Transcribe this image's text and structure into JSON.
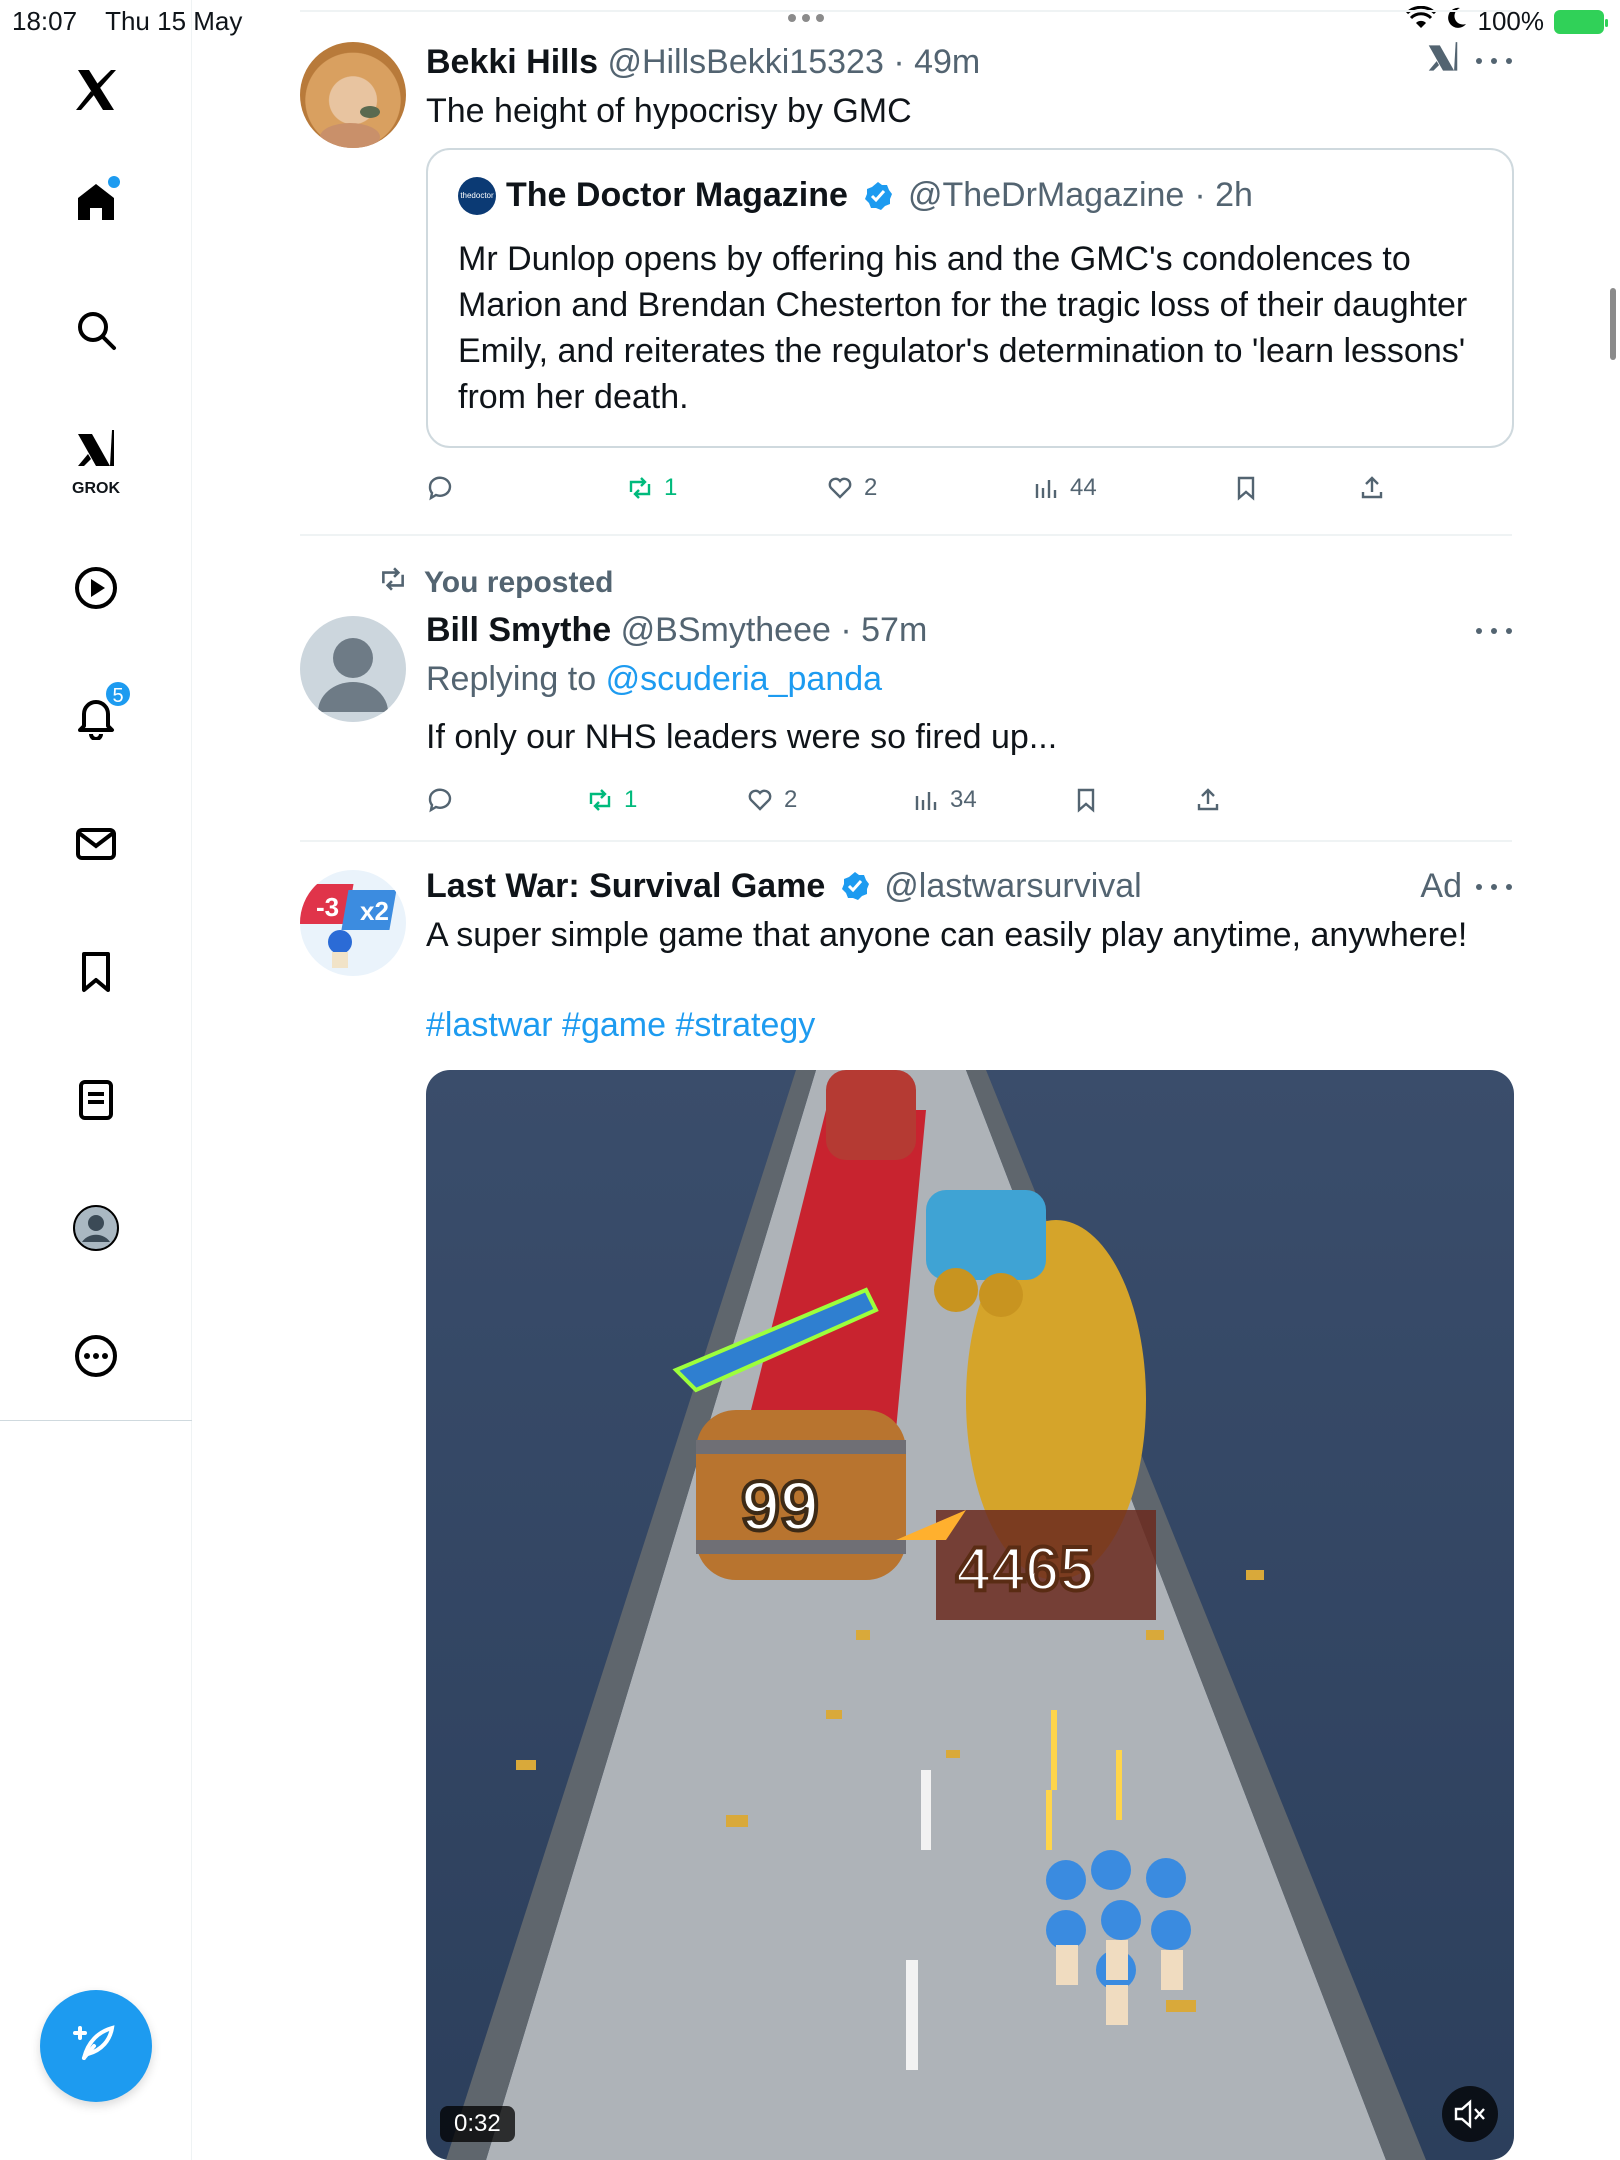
{
  "status_bar": {
    "time": "18:07",
    "date": "Thu 15 May",
    "battery": "100%"
  },
  "sidebar": {
    "items": [
      {
        "name": "x-logo-icon"
      },
      {
        "name": "home-icon"
      },
      {
        "name": "search-icon"
      },
      {
        "name": "grok-icon",
        "label": "GROK"
      },
      {
        "name": "video-icon"
      },
      {
        "name": "notifications-icon",
        "badge": "5"
      },
      {
        "name": "messages-icon"
      },
      {
        "name": "bookmarks-icon"
      },
      {
        "name": "lists-icon"
      },
      {
        "name": "profile-icon"
      },
      {
        "name": "more-icon"
      }
    ],
    "accent": "#1d9bf0"
  },
  "posts": [
    {
      "name": "Bekki Hills",
      "handle": "@HillsBekki15323",
      "time": "· 49m",
      "text": "The height of hypocrisy by GMC",
      "quote": {
        "name": "The Doctor Magazine",
        "avatar_text": "thedoctor",
        "handle": "@TheDrMagazine",
        "time": "· 2h",
        "text": "Mr Dunlop opens by offering his and the GMC's condolences to Marion and Brendan Chesterton for the tragic loss of their daughter Emily, and reiterates the regulator's determination to 'learn lessons' from her death."
      },
      "actions": {
        "replies": "",
        "reposts": "1",
        "likes": "2",
        "views": "44"
      }
    },
    {
      "context": "You reposted",
      "name": "Bill Smythe",
      "handle": "@BSmytheee",
      "time": "· 57m",
      "replying_prefix": "Replying to",
      "replying_to": "@scuderia_panda",
      "text": "If only our NHS leaders were so fired up...",
      "actions": {
        "replies": "",
        "reposts": "1",
        "likes": "2",
        "views": "34"
      }
    },
    {
      "name": "Last War: Survival Game",
      "handle": "@lastwarsurvival",
      "ad_label": "Ad",
      "text": "A super simple game that anyone can easily play anytime, anywhere!",
      "hashtags": "#lastwar #game #strategy",
      "video_time": "0:32",
      "avatar_labels": {
        "minus": "-3",
        "times": "x2"
      },
      "video_labels": {
        "barrel": "99",
        "gate": "4465"
      }
    }
  ]
}
